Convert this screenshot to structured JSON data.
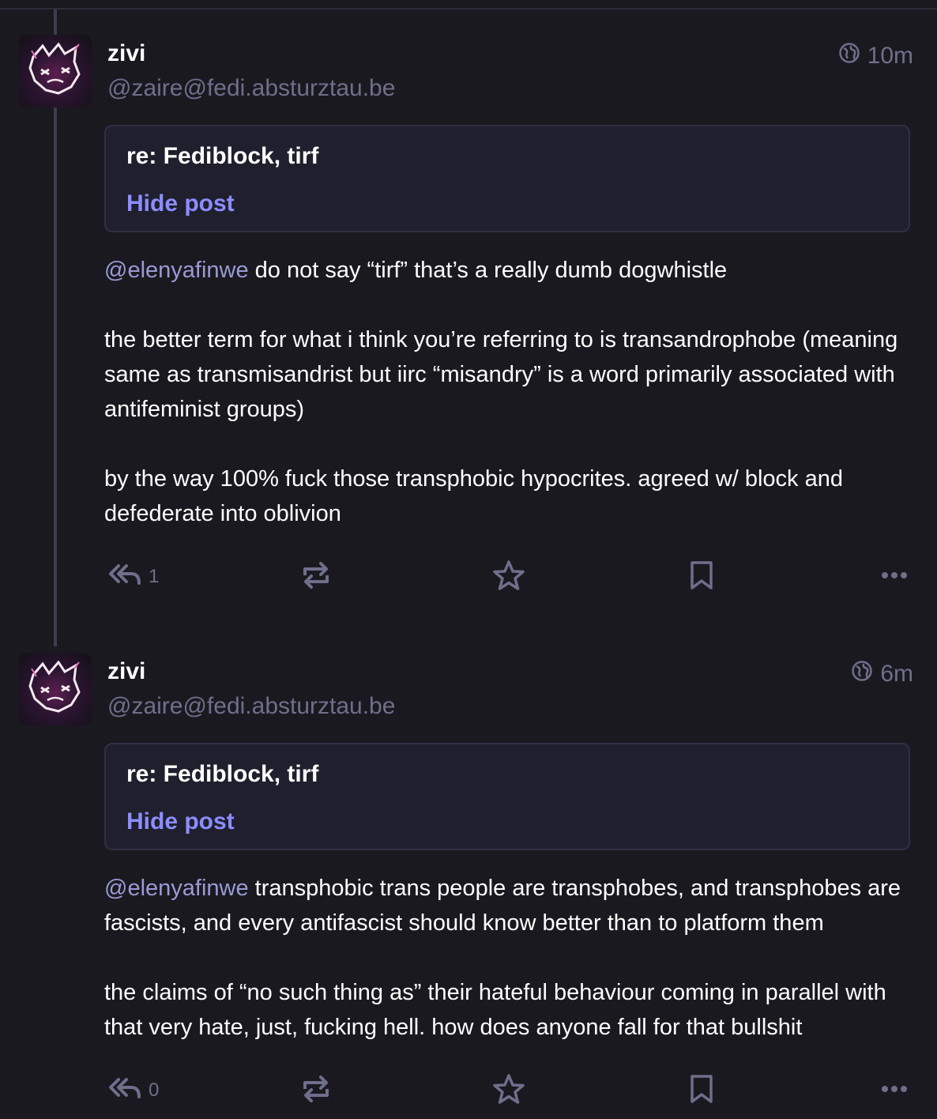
{
  "posts": [
    {
      "display_name": "zivi",
      "acct": "@zaire@fedi.absturztau.be",
      "time": "10m",
      "visibility_icon": "globe-icon",
      "cw_text": "re: Fediblock, tirf",
      "cw_toggle": "Hide post",
      "paragraphs": [
        {
          "mention": "@elenyafinwe",
          "text": " do not say “tirf” that’s a really dumb dogwhistle"
        },
        {
          "mention": "",
          "text": "the better term for what i think you’re referring to is transandrophobe (meaning same as transmisandrist but iirc “misandry” is a word primarily associated with antifeminist groups)"
        },
        {
          "mention": "",
          "text": "by the way 100% fuck those transphobic hypocrites. agreed w/ block and defederate into oblivion"
        }
      ],
      "reply_count": "1"
    },
    {
      "display_name": "zivi",
      "acct": "@zaire@fedi.absturztau.be",
      "time": "6m",
      "visibility_icon": "globe-icon",
      "cw_text": "re: Fediblock, tirf",
      "cw_toggle": "Hide post",
      "paragraphs": [
        {
          "mention": "@elenyafinwe",
          "text": " transphobic trans people are transphobes, and transphobes are fascists, and every antifascist should know better than to platform them"
        },
        {
          "mention": "",
          "text": "the claims of “no such thing as” their hateful behaviour coming in parallel with that very hate, just, fucking hell. how does anyone fall for that bullshit"
        }
      ],
      "reply_count": "0"
    }
  ],
  "action_icons": [
    "reply-all-icon",
    "boost-icon",
    "favourite-star-icon",
    "bookmark-icon",
    "more-options-icon"
  ],
  "colors": {
    "background": "#19191f",
    "muted_text": "#6f6f8c",
    "link": "#8c8dff",
    "cw_background": "#1f1f2d",
    "cw_border": "#2f2f45",
    "mention": "#9a9ad6"
  }
}
